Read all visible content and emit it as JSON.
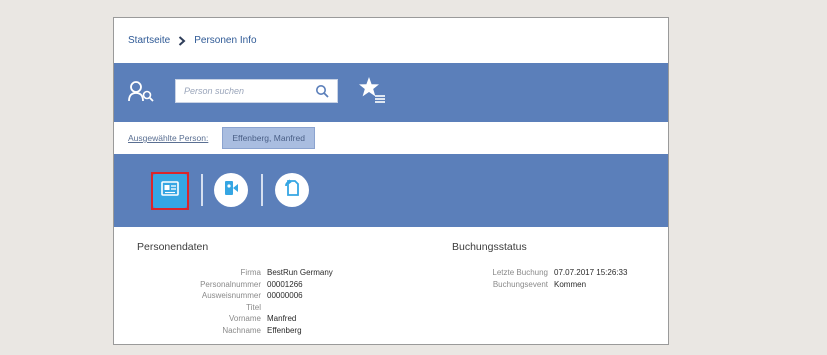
{
  "breadcrumb": {
    "home": "Startseite",
    "current": "Personen Info"
  },
  "toolbar": {
    "search_placeholder": "Person suchen"
  },
  "selected_person": {
    "label": "Ausgewählte Person:",
    "name": "Effenberg, Manfred"
  },
  "actions": [
    {
      "icon": "person-card-icon",
      "active": true
    },
    {
      "icon": "person-arrow-icon",
      "active": false
    },
    {
      "icon": "document-refresh-icon",
      "active": false
    }
  ],
  "personal_data": {
    "title": "Personendaten",
    "fields": [
      {
        "label": "Firma",
        "value": "BestRun Germany"
      },
      {
        "label": "Personalnummer",
        "value": "00001266"
      },
      {
        "label": "Ausweisnummer",
        "value": "00000006"
      },
      {
        "label": "Titel",
        "value": ""
      },
      {
        "label": "Vorname",
        "value": "Manfred"
      },
      {
        "label": "Nachname",
        "value": "Effenberg"
      }
    ]
  },
  "booking_status": {
    "title": "Buchungsstatus",
    "fields": [
      {
        "label": "Letzte Buchung",
        "value": "07.07.2017 15:26:33"
      },
      {
        "label": "Buchungsevent",
        "value": "Kommen"
      }
    ]
  },
  "colors": {
    "brand_blue": "#5b7fba",
    "active_button": "#35a6e3",
    "highlight_red": "#d9262b"
  }
}
